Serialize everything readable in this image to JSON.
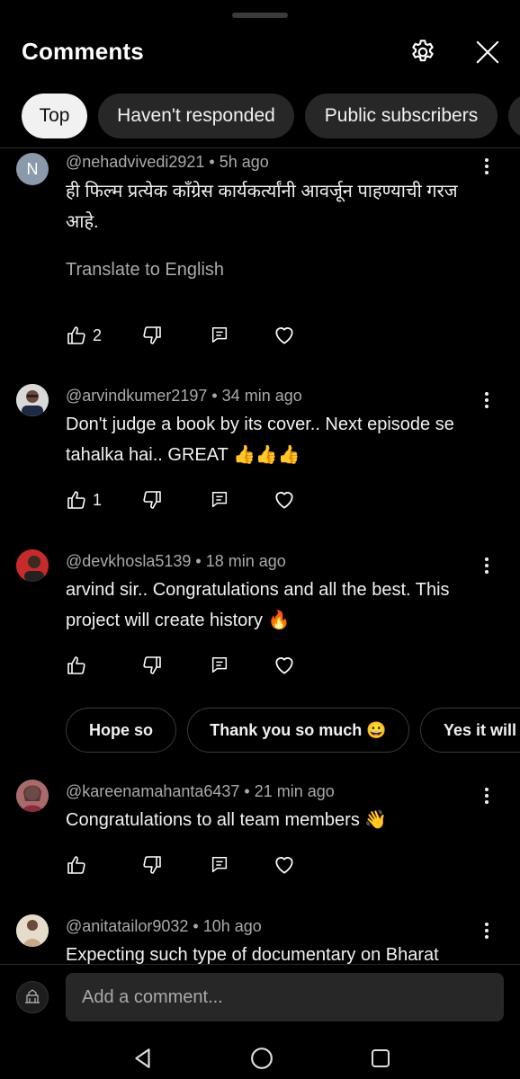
{
  "header": {
    "title": "Comments",
    "settings_icon": "gear-icon",
    "close_icon": "close-icon"
  },
  "filters": [
    {
      "label": "Top",
      "active": true
    },
    {
      "label": "Haven't responded",
      "active": false
    },
    {
      "label": "Public subscribers",
      "active": false
    }
  ],
  "comments": [
    {
      "initial": "N",
      "author": "@nehadvivedi2921",
      "time": "5h ago",
      "text": "ही फिल्म प्रत्येक काँग्रेस कार्यकर्त्यांनी आवर्जून पाहण्याची गरज आहे.",
      "translate": "Translate to English",
      "likes": "2"
    },
    {
      "author": "@arvindkumer2197",
      "time": "34 min ago",
      "text": "Don't judge a book by its cover.. Next episode se tahalka hai.. GREAT 👍👍👍",
      "likes": "1"
    },
    {
      "author": "@devkhosla5139",
      "time": "18 min ago",
      "text": "arvind sir.. Congratulations and all the best. This project will create history 🔥",
      "likes": ""
    },
    {
      "author": "@kareenamahanta6437",
      "time": "21 min ago",
      "text": "Congratulations to all team members 👋",
      "likes": ""
    },
    {
      "author": "@anitatailor9032",
      "time": "10h ago",
      "text": "Expecting such type of documentary on Bharat",
      "likes": ""
    }
  ],
  "suggested_replies": [
    "Hope so",
    "Thank you so much 😀",
    "Yes it will"
  ],
  "compose": {
    "placeholder": "Add a comment..."
  },
  "colors": {
    "background": "#000000",
    "chip_bg": "#272727",
    "chip_active_bg": "#f1f1f1",
    "secondary_text": "#aaaaaa"
  }
}
